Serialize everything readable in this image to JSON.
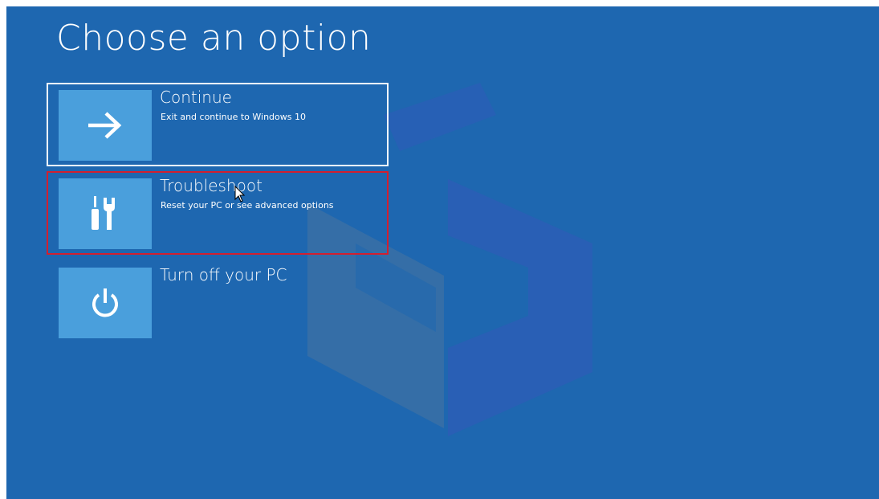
{
  "page": {
    "title": "Choose an option"
  },
  "options": [
    {
      "id": "continue",
      "label": "Continue",
      "description": "Exit and continue to Windows 10",
      "icon": "arrow-right-icon",
      "state": "focused"
    },
    {
      "id": "troubleshoot",
      "label": "Troubleshoot",
      "description": "Reset your PC or see advanced options",
      "icon": "tools-icon",
      "state": "highlighted"
    },
    {
      "id": "turn-off",
      "label": "Turn off your PC",
      "description": "",
      "icon": "power-icon",
      "state": "normal"
    }
  ],
  "colors": {
    "background": "#1e67b0",
    "icon_tile": "#4a9fdc",
    "focus_border": "#ffffff",
    "highlight_border": "#d31f2f"
  }
}
